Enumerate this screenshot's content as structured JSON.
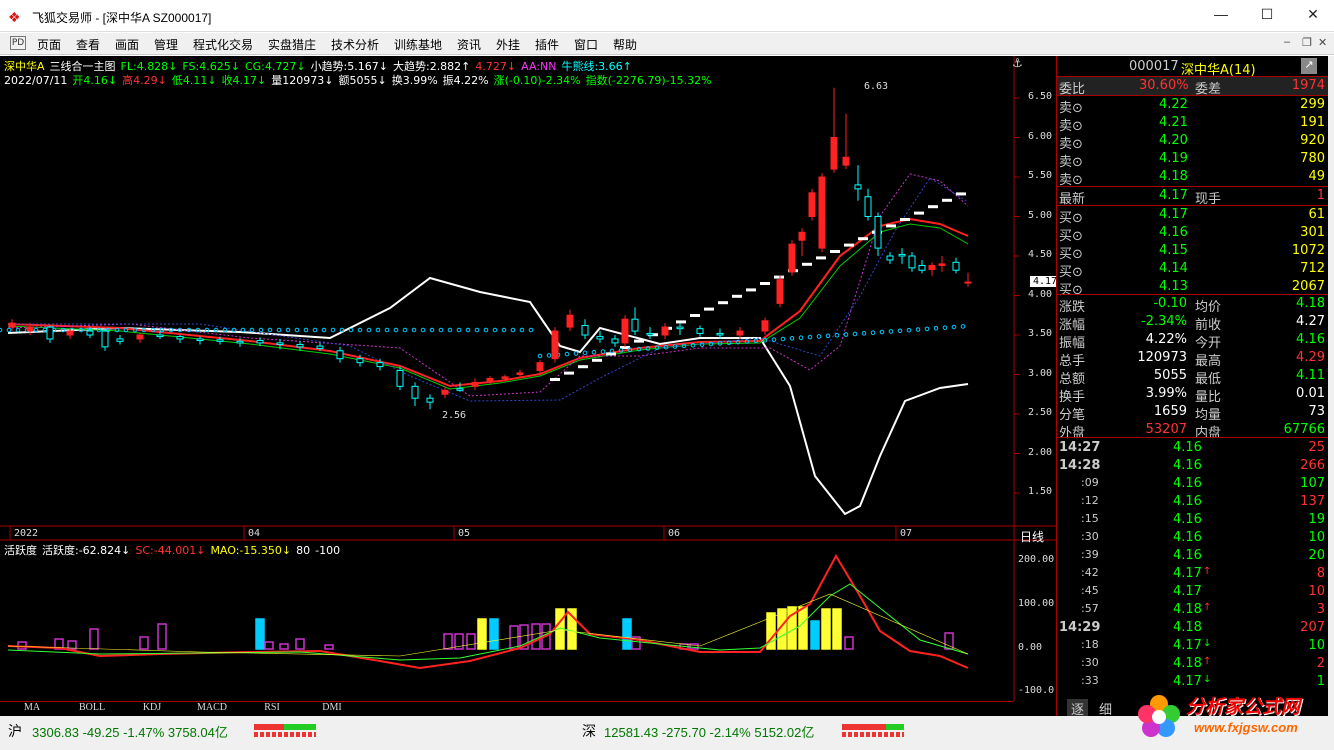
{
  "window": {
    "title": "飞狐交易师 - [深中华A SZ000017]",
    "minimize": "—",
    "maximize": "☐",
    "close": "✕"
  },
  "menu": [
    "页面",
    "查看",
    "画面",
    "管理",
    "程式化交易",
    "实盘猎庄",
    "技术分析",
    "训练基地",
    "资讯",
    "外挂",
    "插件",
    "窗口",
    "帮助"
  ],
  "menu_icon": "PD",
  "chart_header": {
    "line1": [
      {
        "t": "深中华A",
        "c": "#ffff00"
      },
      {
        "t": "三线合一主图",
        "c": "#ffffff"
      },
      {
        "t": "FL:4.828↓",
        "c": "#00ff00"
      },
      {
        "t": "FS:4.625↓",
        "c": "#00ff00"
      },
      {
        "t": "CG:4.727↓",
        "c": "#00ff00"
      },
      {
        "t": "小趋势:5.167↓",
        "c": "#ffffff"
      },
      {
        "t": "大趋势:2.882↑",
        "c": "#ffffff"
      },
      {
        "t": "4.727↓",
        "c": "#ff3333"
      },
      {
        "t": "AA:NN",
        "c": "#ff33ff"
      },
      {
        "t": "牛熊线:3.66↑",
        "c": "#00ffff"
      }
    ],
    "line2": [
      {
        "t": "2022/07/11",
        "c": "#ffffff"
      },
      {
        "t": "开4.16↓",
        "c": "#00ff00"
      },
      {
        "t": "高4.29↓",
        "c": "#ff3333"
      },
      {
        "t": "低4.11↓",
        "c": "#00ff00"
      },
      {
        "t": "收4.17↓",
        "c": "#00ff00"
      },
      {
        "t": "量120973↓",
        "c": "#ffffff"
      },
      {
        "t": "额5055↓",
        "c": "#ffffff"
      },
      {
        "t": "换3.99%",
        "c": "#ffffff"
      },
      {
        "t": "振4.22%",
        "c": "#ffffff"
      },
      {
        "t": "涨(-0.10)-2.34%",
        "c": "#00ff00"
      },
      {
        "t": "指数(-2276.79)-15.32%",
        "c": "#00ff00"
      }
    ]
  },
  "price_axis": [
    "6.50",
    "6.00",
    "5.50",
    "5.00",
    "4.50",
    "4.00",
    "3.50",
    "3.00",
    "2.50",
    "2.00",
    "1.50"
  ],
  "current_price_tag": "4.17",
  "annotations": {
    "high": "6.63",
    "low": "2.56"
  },
  "date_axis": [
    "2022",
    "04",
    "05",
    "06",
    "07"
  ],
  "period_label": "日线",
  "indicator_header": [
    {
      "t": "活跃度",
      "c": "#ffffff"
    },
    {
      "t": "活跃度:-62.824↓",
      "c": "#ffffff"
    },
    {
      "t": "SC:-44.001↓",
      "c": "#ff3333"
    },
    {
      "t": "MAO:-15.350↓",
      "c": "#ffff00"
    },
    {
      "t": "80",
      "c": "#ffffff"
    },
    {
      "t": "-100",
      "c": "#ffffff"
    }
  ],
  "indicator_axis": [
    "200.00",
    "100.00",
    "0.00",
    "-100.0"
  ],
  "indicator_tabs": [
    "MA",
    "BOLL",
    "KDJ",
    "MACD",
    "RSI",
    "DMI"
  ],
  "panel": {
    "code": "000017",
    "name": "深中华A(14)",
    "weibi": {
      "l1": "委比",
      "v1": "30.60%",
      "l2": "委差",
      "v2": "1974"
    },
    "sells": [
      {
        "l": "卖⊙",
        "p": "4.22",
        "v": "299"
      },
      {
        "l": "卖⊙",
        "p": "4.21",
        "v": "191"
      },
      {
        "l": "卖⊙",
        "p": "4.20",
        "v": "920"
      },
      {
        "l": "卖⊙",
        "p": "4.19",
        "v": "780"
      },
      {
        "l": "卖⊙",
        "p": "4.18",
        "v": "49"
      }
    ],
    "latest": {
      "l": "最新",
      "p": "4.17",
      "l2": "现手",
      "v": "1"
    },
    "buys": [
      {
        "l": "买⊙",
        "p": "4.17",
        "v": "61"
      },
      {
        "l": "买⊙",
        "p": "4.16",
        "v": "301"
      },
      {
        "l": "买⊙",
        "p": "4.15",
        "v": "1072"
      },
      {
        "l": "买⊙",
        "p": "4.14",
        "v": "712"
      },
      {
        "l": "买⊙",
        "p": "4.13",
        "v": "2067"
      }
    ],
    "stats": [
      {
        "l1": "涨跌",
        "v1": "-0.10",
        "c1": "#00ff00",
        "l2": "均价",
        "v2": "4.18",
        "c2": "#00ff00"
      },
      {
        "l1": "涨幅",
        "v1": "-2.34%",
        "c1": "#00ff00",
        "l2": "前收",
        "v2": "4.27",
        "c2": "#ffffff"
      },
      {
        "l1": "振幅",
        "v1": "4.22%",
        "c1": "#ffffff",
        "l2": "今开",
        "v2": "4.16",
        "c2": "#00ff00"
      },
      {
        "l1": "总手",
        "v1": "120973",
        "c1": "#ffffff",
        "l2": "最高",
        "v2": "4.29",
        "c2": "#ff3333"
      },
      {
        "l1": "总额",
        "v1": "5055",
        "c1": "#ffffff",
        "l2": "最低",
        "v2": "4.11",
        "c2": "#00ff00"
      },
      {
        "l1": "换手",
        "v1": "3.99%",
        "c1": "#ffffff",
        "l2": "量比",
        "v2": "0.01",
        "c2": "#ffffff"
      },
      {
        "l1": "分笔",
        "v1": "1659",
        "c1": "#ffffff",
        "l2": "均量",
        "v2": "73",
        "c2": "#ffffff"
      },
      {
        "l1": "外盘",
        "v1": "53207",
        "c1": "#ff3333",
        "l2": "内盘",
        "v2": "67766",
        "c2": "#00ff00"
      }
    ],
    "ticks": [
      {
        "t": "14:27",
        "p": "4.16",
        "v": "25",
        "vc": "#ff3333",
        "a": ""
      },
      {
        "t": "14:28",
        "p": "4.16",
        "v": "266",
        "vc": "#ff3333",
        "a": ""
      },
      {
        "t": ":09",
        "p": "4.16",
        "v": "107",
        "vc": "#00ff00",
        "a": ""
      },
      {
        "t": ":12",
        "p": "4.16",
        "v": "137",
        "vc": "#ff3333",
        "a": ""
      },
      {
        "t": ":15",
        "p": "4.16",
        "v": "19",
        "vc": "#00ff00",
        "a": ""
      },
      {
        "t": ":30",
        "p": "4.16",
        "v": "10",
        "vc": "#00ff00",
        "a": ""
      },
      {
        "t": ":39",
        "p": "4.16",
        "v": "20",
        "vc": "#00ff00",
        "a": ""
      },
      {
        "t": ":42",
        "p": "4.17",
        "v": "8",
        "vc": "#ff3333",
        "a": "↑"
      },
      {
        "t": ":45",
        "p": "4.17",
        "v": "10",
        "vc": "#ff3333",
        "a": ""
      },
      {
        "t": ":57",
        "p": "4.18",
        "v": "3",
        "vc": "#ff3333",
        "a": "↑"
      },
      {
        "t": "14:29",
        "p": "4.18",
        "v": "207",
        "vc": "#ff3333",
        "a": ""
      },
      {
        "t": ":18",
        "p": "4.17",
        "v": "10",
        "vc": "#00ff00",
        "a": "↓"
      },
      {
        "t": ":30",
        "p": "4.18",
        "v": "2",
        "vc": "#ff3333",
        "a": "↑"
      },
      {
        "t": ":33",
        "p": "4.17",
        "v": "1",
        "vc": "#00ff00",
        "a": "↓"
      }
    ],
    "bottom_tabs": [
      "逐",
      "细"
    ]
  },
  "status": {
    "sh_label": "沪",
    "sh": "3306.83 -49.25 -1.47% 3758.04亿",
    "sz_label": "深",
    "sz": "12581.43 -275.70 -2.14% 5152.02亿"
  },
  "watermark": {
    "text": "分析家公式网",
    "url": "www.fxjgsw.com"
  }
}
